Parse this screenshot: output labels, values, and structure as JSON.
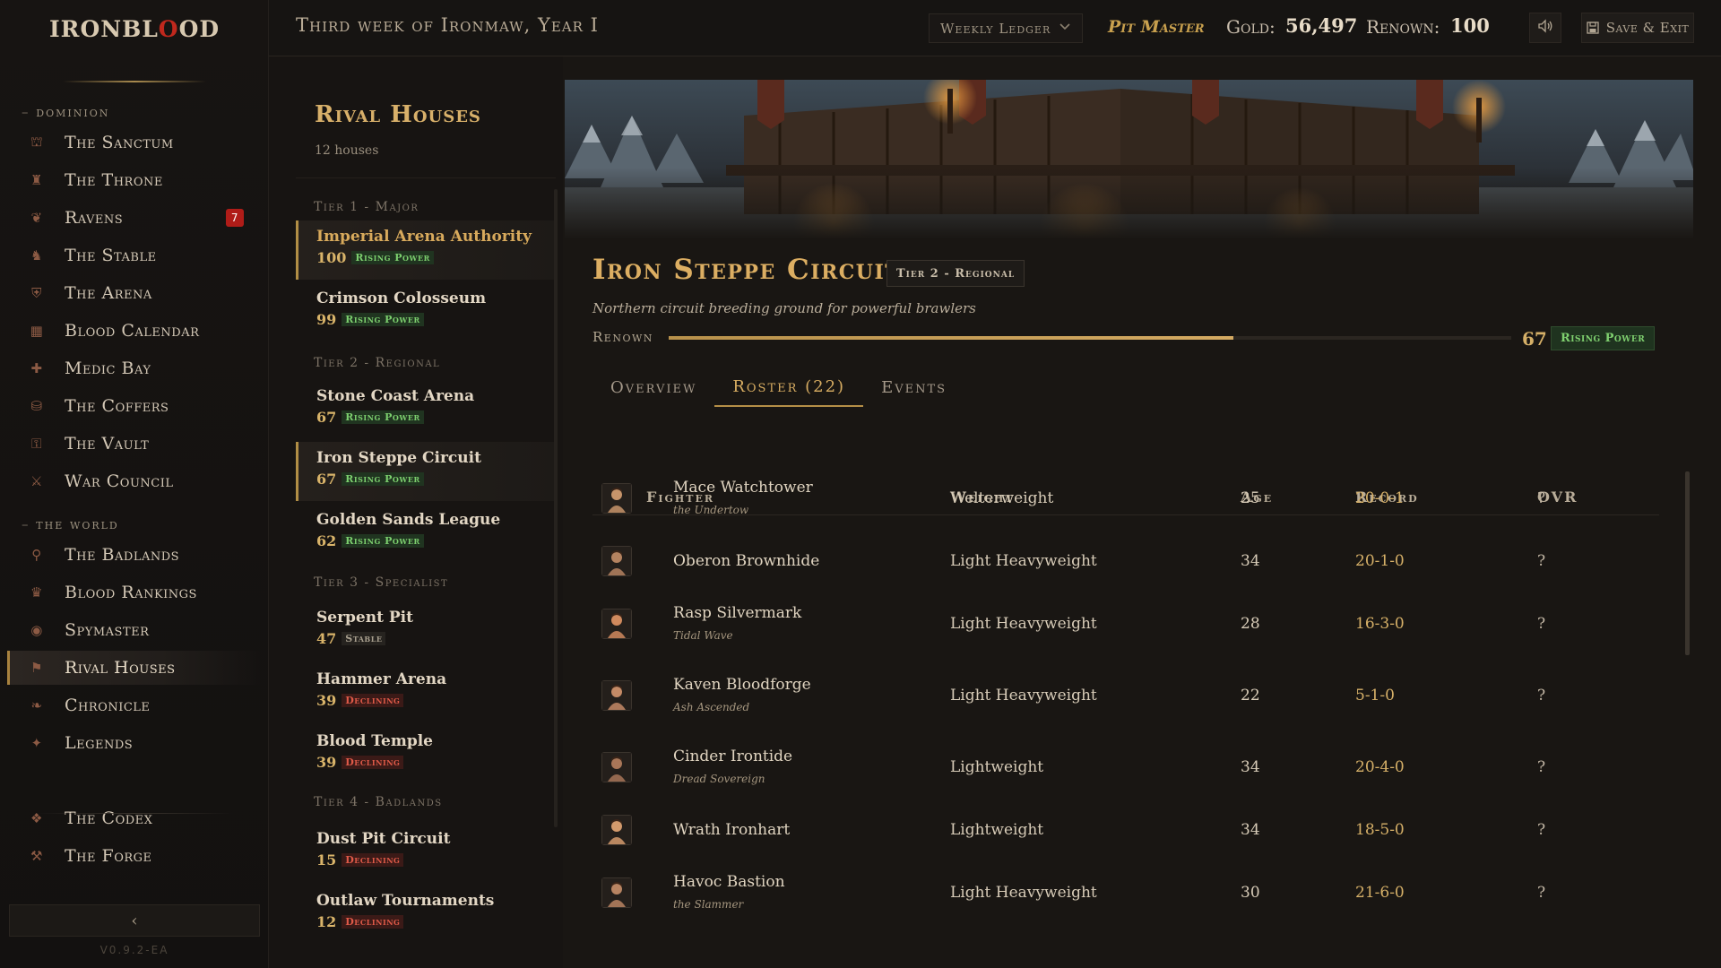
{
  "app": {
    "logo_pre": "IRONBL",
    "logo_o": "O",
    "logo_post": "OD",
    "version": "V0.9.2-EA"
  },
  "sidebar": {
    "sections": [
      {
        "label": "dominion"
      },
      {
        "label": "the world"
      }
    ],
    "items": [
      {
        "label": "The Sanctum",
        "icon": "altar-icon"
      },
      {
        "label": "The Throne",
        "icon": "throne-icon"
      },
      {
        "label": "Ravens",
        "icon": "raven-icon",
        "badge": "7"
      },
      {
        "label": "The Stable",
        "icon": "stable-icon"
      },
      {
        "label": "The Arena",
        "icon": "arena-icon"
      },
      {
        "label": "Blood Calendar",
        "icon": "calendar-icon"
      },
      {
        "label": "Medic Bay",
        "icon": "medic-icon"
      },
      {
        "label": "The Coffers",
        "icon": "coffers-icon"
      },
      {
        "label": "The Vault",
        "icon": "vault-icon"
      },
      {
        "label": "War Council",
        "icon": "war-council-icon"
      },
      {
        "label": "The Badlands",
        "icon": "badlands-icon"
      },
      {
        "label": "Blood Rankings",
        "icon": "trophy-icon"
      },
      {
        "label": "Spymaster",
        "icon": "eye-icon"
      },
      {
        "label": "Rival Houses",
        "icon": "rival-houses-icon",
        "active": true
      },
      {
        "label": "Chronicle",
        "icon": "chronicle-icon"
      },
      {
        "label": "Legends",
        "icon": "legends-icon"
      },
      {
        "label": "The Codex",
        "icon": "codex-icon"
      },
      {
        "label": "The Forge",
        "icon": "forge-icon"
      }
    ],
    "collapse_glyph": "‹"
  },
  "topbar": {
    "date": "Third week of Ironmaw, Year I",
    "ledger": "Weekly Ledger",
    "rank": "Pit Master",
    "gold_label": "Gold:",
    "gold_value": "56,497",
    "renown_label": "Renown:",
    "renown_value": "100",
    "save_label": "Save & Exit"
  },
  "houses": {
    "title": "Rival Houses",
    "count": "12 houses",
    "tiers": [
      "Tier 1 - Major",
      "Tier 2 - Regional",
      "Tier 3 - Specialist",
      "Tier 4 - Badlands"
    ],
    "list": [
      {
        "name": "Imperial Arena Authority",
        "score": "100",
        "status": "Rising Power",
        "kind": "rising",
        "highlight": true
      },
      {
        "name": "Crimson Colosseum",
        "score": "99",
        "status": "Rising Power",
        "kind": "rising"
      },
      {
        "name": "Stone Coast Arena",
        "score": "67",
        "status": "Rising Power",
        "kind": "rising"
      },
      {
        "name": "Iron Steppe Circuit",
        "score": "67",
        "status": "Rising Power",
        "kind": "rising",
        "selected": true
      },
      {
        "name": "Golden Sands League",
        "score": "62",
        "status": "Rising Power",
        "kind": "rising"
      },
      {
        "name": "Serpent Pit",
        "score": "47",
        "status": "Stable",
        "kind": "stable"
      },
      {
        "name": "Hammer Arena",
        "score": "39",
        "status": "Declining",
        "kind": "declining"
      },
      {
        "name": "Blood Temple",
        "score": "39",
        "status": "Declining",
        "kind": "declining"
      },
      {
        "name": "Dust Pit Circuit",
        "score": "15",
        "status": "Declining",
        "kind": "declining"
      },
      {
        "name": "Outlaw Tournaments",
        "score": "12",
        "status": "Declining",
        "kind": "declining"
      }
    ]
  },
  "detail": {
    "name": "Iron Steppe Circuit",
    "tier": "Tier 2 - Regional",
    "description": "Northern circuit breeding ground for powerful brawlers",
    "renown_label": "Renown",
    "renown_value": "67",
    "renown_fraction": 0.67,
    "renown_status": "Rising Power",
    "tabs": [
      "Overview",
      "Roster (22)",
      "Events"
    ],
    "active_tab": 1
  },
  "roster": {
    "headers": {
      "fighter": "Fighter",
      "weight": "Weight",
      "age": "Age",
      "record": "Record",
      "ovr": "OVR"
    },
    "rows": [
      {
        "name": "Mace Watchtower",
        "nickname": "the Undertow",
        "weight": "Welterweight",
        "age": "25",
        "record": "20-0-1",
        "ovr": "?"
      },
      {
        "name": "Oberon Brownhide",
        "nickname": "",
        "weight": "Light Heavyweight",
        "age": "34",
        "record": "20-1-0",
        "ovr": "?"
      },
      {
        "name": "Rasp Silvermark",
        "nickname": "Tidal Wave",
        "weight": "Light Heavyweight",
        "age": "28",
        "record": "16-3-0",
        "ovr": "?"
      },
      {
        "name": "Kaven Bloodforge",
        "nickname": "Ash Ascended",
        "weight": "Light Heavyweight",
        "age": "22",
        "record": "5-1-0",
        "ovr": "?"
      },
      {
        "name": "Cinder Irontide",
        "nickname": "Dread Sovereign",
        "weight": "Lightweight",
        "age": "34",
        "record": "20-4-0",
        "ovr": "?"
      },
      {
        "name": "Wrath Ironhart",
        "nickname": "",
        "weight": "Lightweight",
        "age": "34",
        "record": "18-5-0",
        "ovr": "?"
      },
      {
        "name": "Havoc Bastion",
        "nickname": "the Slammer",
        "weight": "Light Heavyweight",
        "age": "30",
        "record": "21-6-0",
        "ovr": "?"
      }
    ]
  },
  "colors": {
    "accent_gold": "#d8ad62",
    "rising": "#7ccf6e",
    "declining": "#e05a48",
    "badge_red": "#b01c18"
  }
}
